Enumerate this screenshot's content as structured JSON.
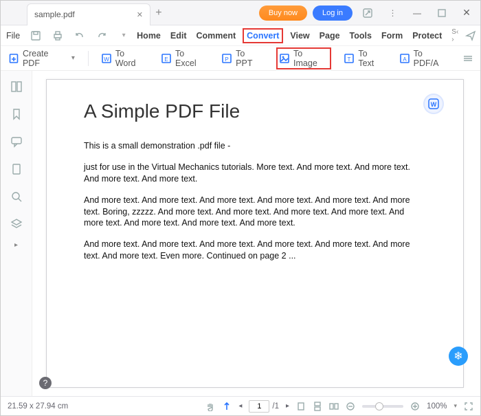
{
  "titlebar": {
    "tab_name": "sample.pdf",
    "buy": "Buy now",
    "login": "Log in"
  },
  "menubar": {
    "file": "File",
    "tabs": [
      "Home",
      "Edit",
      "Comment",
      "Convert",
      "View",
      "Page",
      "Tools",
      "Form",
      "Protect"
    ],
    "highlighted": "Convert"
  },
  "toolbar": {
    "create": "Create PDF",
    "to_word": "To Word",
    "to_excel": "To Excel",
    "to_ppt": "To PPT",
    "to_image": "To Image",
    "to_text": "To Text",
    "to_pdfa": "To PDF/A"
  },
  "document": {
    "heading": "A Simple PDF File",
    "p1": "This is a small demonstration .pdf file -",
    "p2": "just for use in the Virtual Mechanics tutorials. More text. And more text. And more text. And more text. And more text.",
    "p3": "And more text. And more text. And more text. And more text. And more text. And more text. Boring, zzzzz. And more text. And more text. And more text. And more text. And more text. And more text. And more text. And more text.",
    "p4": "And more text. And more text. And more text. And more text. And more text. And more text. And more text. Even more. Continued on page 2 ..."
  },
  "statusbar": {
    "size": "21.59 x 27.94 cm",
    "page_current": "1",
    "page_total": "/1",
    "zoom": "100%"
  }
}
